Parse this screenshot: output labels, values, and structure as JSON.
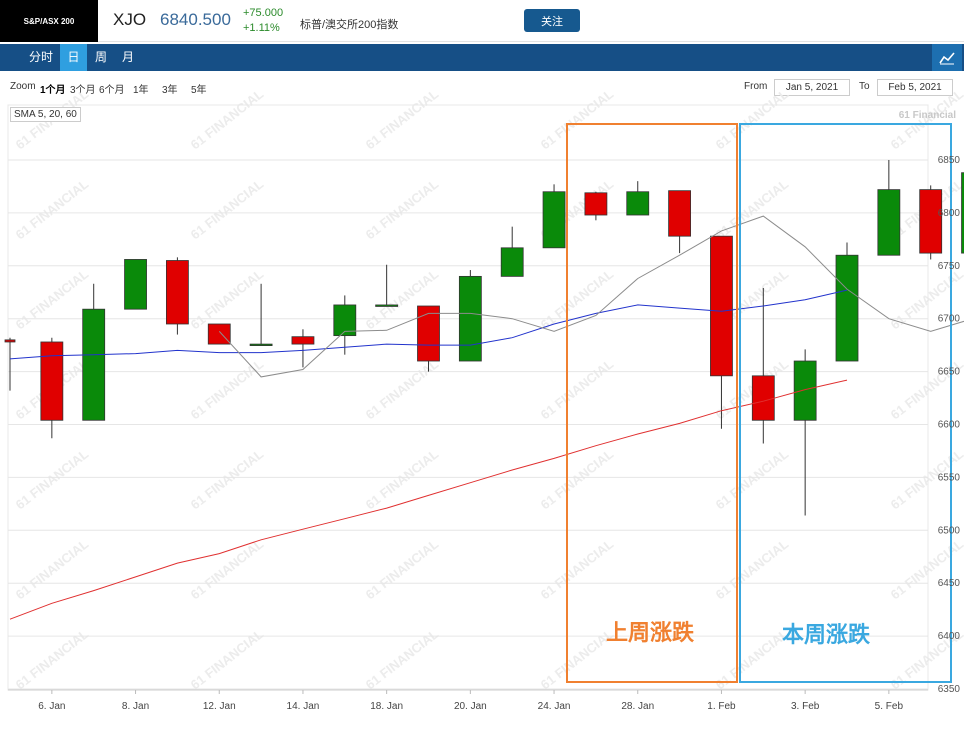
{
  "header": {
    "logo_text": "S&P/ASX 200",
    "ticker": "XJO",
    "price": "6840.500",
    "change": "+75.000",
    "change_pct": "+1.11%",
    "name": "标普/澳交所200指数",
    "follow_label": "关注"
  },
  "tabs": [
    {
      "label": "分时",
      "active": false
    },
    {
      "label": "日",
      "active": true
    },
    {
      "label": "周",
      "active": false
    },
    {
      "label": "月",
      "active": false
    }
  ],
  "zoom": {
    "label": "Zoom",
    "options": [
      "1个月",
      "3个月",
      "6个月",
      "1年",
      "3年",
      "5年"
    ],
    "selected": "1个月",
    "from_label": "From",
    "from_value": "Jan 5, 2021",
    "to_label": "To",
    "to_value": "Feb 5, 2021"
  },
  "sma_label": "SMA 5, 20, 60",
  "brand_text": "61 Financial",
  "watermark_text": "61 FINANCIAL",
  "colors": {
    "up": "#0a8a0a",
    "down": "#e00000",
    "sma5": "#8c8c8c",
    "sma20": "#2233cc",
    "sma60": "#e03030",
    "box_last_week": "#f08030",
    "box_this_week": "#3aa8e0",
    "nav": "#164f86"
  },
  "annotations": {
    "last_week": "上周涨跌",
    "this_week": "本周涨跌"
  },
  "chart_data": {
    "type": "candlestick",
    "ylim": [
      6350,
      6860
    ],
    "yticks": [
      6350,
      6400,
      6450,
      6500,
      6550,
      6600,
      6650,
      6700,
      6750,
      6800,
      6850
    ],
    "xtick_labels": [
      "6. Jan",
      "8. Jan",
      "12. Jan",
      "14. Jan",
      "18. Jan",
      "20. Jan",
      "24. Jan",
      "28. Jan",
      "1. Feb",
      "3. Feb",
      "5. Feb"
    ],
    "xtick_index": [
      1,
      3,
      5,
      7,
      9,
      11,
      13,
      15,
      17,
      19,
      21
    ],
    "candles": [
      {
        "open": 6680,
        "high": 6682,
        "low": 6632,
        "close": 6678
      },
      {
        "open": 6678,
        "high": 6682,
        "low": 6587,
        "close": 6604
      },
      {
        "open": 6604,
        "high": 6733,
        "low": 6604,
        "close": 6709
      },
      {
        "open": 6709,
        "high": 6756,
        "low": 6709,
        "close": 6756
      },
      {
        "open": 6755,
        "high": 6758,
        "low": 6685,
        "close": 6695
      },
      {
        "open": 6695,
        "high": 6695,
        "low": 6676,
        "close": 6676
      },
      {
        "open": 6676,
        "high": 6733,
        "low": 6676,
        "close": 6676
      },
      {
        "open": 6683,
        "high": 6690,
        "low": 6654,
        "close": 6676
      },
      {
        "open": 6684,
        "high": 6722,
        "low": 6666,
        "close": 6713
      },
      {
        "open": 6713,
        "high": 6751,
        "low": 6713,
        "close": 6713
      },
      {
        "open": 6712,
        "high": 6712,
        "low": 6650,
        "close": 6660
      },
      {
        "open": 6660,
        "high": 6746,
        "low": 6660,
        "close": 6740
      },
      {
        "open": 6740,
        "high": 6787,
        "low": 6740,
        "close": 6767
      },
      {
        "open": 6767,
        "high": 6827,
        "low": 6767,
        "close": 6820
      },
      {
        "open": 6819,
        "high": 6820,
        "low": 6793,
        "close": 6798
      },
      {
        "open": 6798,
        "high": 6830,
        "low": 6798,
        "close": 6820
      },
      {
        "open": 6821,
        "high": 6821,
        "low": 6762,
        "close": 6778
      },
      {
        "open": 6778,
        "high": 6778,
        "low": 6596,
        "close": 6646
      },
      {
        "open": 6646,
        "high": 6729,
        "low": 6582,
        "close": 6604
      },
      {
        "open": 6604,
        "high": 6671,
        "low": 6514,
        "close": 6660
      },
      {
        "open": 6660,
        "high": 6772,
        "low": 6660,
        "close": 6760
      },
      {
        "open": 6760,
        "high": 6850,
        "low": 6760,
        "close": 6822
      },
      {
        "open": 6822,
        "high": 6826,
        "low": 6756,
        "close": 6762
      },
      {
        "open": 6762,
        "high": 6845,
        "low": 6762,
        "close": 6838
      }
    ],
    "sma5": [
      [
        5,
        6688
      ],
      [
        6,
        6645
      ],
      [
        7,
        6652
      ],
      [
        8,
        6688
      ],
      [
        9,
        6689
      ],
      [
        10,
        6705
      ],
      [
        11,
        6705
      ],
      [
        12,
        6700
      ],
      [
        13,
        6688
      ],
      [
        14,
        6703
      ],
      [
        15,
        6738
      ],
      [
        16,
        6760
      ],
      [
        17,
        6783
      ],
      [
        18,
        6797
      ],
      [
        19,
        6768
      ],
      [
        20,
        6728
      ],
      [
        21,
        6700
      ],
      [
        22,
        6688
      ],
      [
        23,
        6700
      ],
      [
        24,
        6720
      ]
    ],
    "sma20": [
      [
        0,
        6662
      ],
      [
        1,
        6665
      ],
      [
        2,
        6666
      ],
      [
        3,
        6667
      ],
      [
        4,
        6670
      ],
      [
        5,
        6668
      ],
      [
        6,
        6668
      ],
      [
        7,
        6670
      ],
      [
        8,
        6673
      ],
      [
        9,
        6676
      ],
      [
        10,
        6675
      ],
      [
        11,
        6675
      ],
      [
        12,
        6682
      ],
      [
        13,
        6695
      ],
      [
        14,
        6705
      ],
      [
        15,
        6713
      ],
      [
        16,
        6710
      ],
      [
        17,
        6707
      ],
      [
        18,
        6712
      ],
      [
        19,
        6718
      ],
      [
        20,
        6727
      ]
    ],
    "sma60": [
      [
        0,
        6416
      ],
      [
        1,
        6431
      ],
      [
        2,
        6443
      ],
      [
        3,
        6456
      ],
      [
        4,
        6469
      ],
      [
        5,
        6478
      ],
      [
        6,
        6491
      ],
      [
        7,
        6501
      ],
      [
        8,
        6511
      ],
      [
        9,
        6521
      ],
      [
        10,
        6533
      ],
      [
        11,
        6545
      ],
      [
        12,
        6557
      ],
      [
        13,
        6568
      ],
      [
        14,
        6580
      ],
      [
        15,
        6591
      ],
      [
        16,
        6601
      ],
      [
        17,
        6613
      ],
      [
        18,
        6622
      ],
      [
        19,
        6633
      ],
      [
        20,
        6642
      ]
    ]
  }
}
